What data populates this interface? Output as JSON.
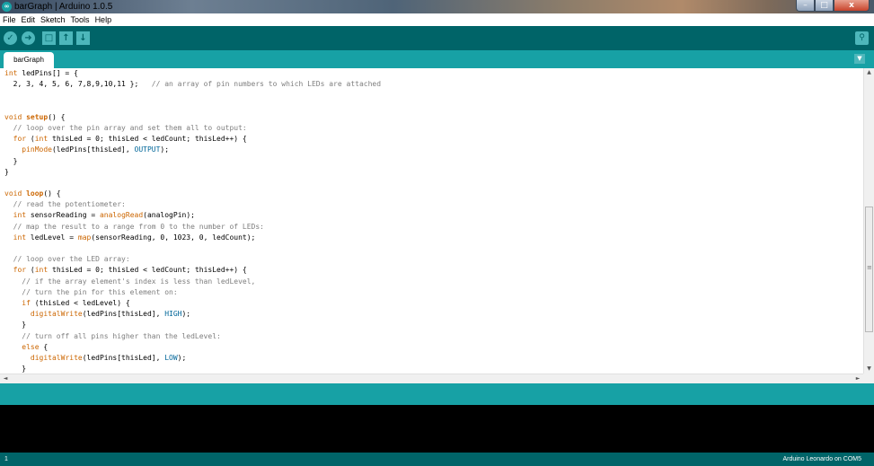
{
  "window": {
    "title": "barGraph | Arduino 1.0.5",
    "icon": "arduino-icon",
    "controls": {
      "minimize": "–",
      "maximize": "□",
      "close": "x"
    }
  },
  "menu": {
    "items": [
      "File",
      "Edit",
      "Sketch",
      "Tools",
      "Help"
    ]
  },
  "toolbar": {
    "verify": "verify-check-icon",
    "upload": "upload-arrow-icon",
    "new": "new-file-icon",
    "open": "open-up-arrow-icon",
    "save": "save-down-arrow-icon",
    "serial_monitor": "magnifier-icon"
  },
  "tabs": {
    "active": "barGraph",
    "menu": "tab-menu-icon"
  },
  "colors": {
    "teal_dark": "#006468",
    "teal_light": "#17a1a5",
    "keyword": "#cc6600",
    "comment": "#7e7e7e",
    "constant": "#006699"
  },
  "editor": {
    "lines": [
      [
        {
          "t": "int",
          "c": "kw"
        },
        {
          "t": " ledPins[] = {"
        }
      ],
      [
        {
          "t": "  2, 3, 4, 5, 6, 7,8,9,10,11 };   "
        },
        {
          "t": "// an array of pin numbers to which LEDs are attached",
          "c": "cm"
        }
      ],
      [],
      [],
      [
        {
          "t": "void",
          "c": "kw"
        },
        {
          "t": " "
        },
        {
          "t": "setup",
          "c": "kwb"
        },
        {
          "t": "() {"
        }
      ],
      [
        {
          "t": "  "
        },
        {
          "t": "// loop over the pin array and set them all to output:",
          "c": "cm"
        }
      ],
      [
        {
          "t": "  "
        },
        {
          "t": "for",
          "c": "kw"
        },
        {
          "t": " ("
        },
        {
          "t": "int",
          "c": "kw"
        },
        {
          "t": " thisLed = 0; thisLed < ledCount; thisLed++) {"
        }
      ],
      [
        {
          "t": "    "
        },
        {
          "t": "pinMode",
          "c": "kw"
        },
        {
          "t": "(ledPins[thisLed], "
        },
        {
          "t": "OUTPUT",
          "c": "cst"
        },
        {
          "t": ");"
        }
      ],
      [
        {
          "t": "  }"
        }
      ],
      [
        {
          "t": "}"
        }
      ],
      [],
      [
        {
          "t": "void",
          "c": "kw"
        },
        {
          "t": " "
        },
        {
          "t": "loop",
          "c": "kwb"
        },
        {
          "t": "() {"
        }
      ],
      [
        {
          "t": "  "
        },
        {
          "t": "// read the potentiometer:",
          "c": "cm"
        }
      ],
      [
        {
          "t": "  "
        },
        {
          "t": "int",
          "c": "kw"
        },
        {
          "t": " sensorReading = "
        },
        {
          "t": "analogRead",
          "c": "kw"
        },
        {
          "t": "(analogPin);"
        }
      ],
      [
        {
          "t": "  "
        },
        {
          "t": "// map the result to a range from 0 to the number of LEDs:",
          "c": "cm"
        }
      ],
      [
        {
          "t": "  "
        },
        {
          "t": "int",
          "c": "kw"
        },
        {
          "t": " ledLevel = "
        },
        {
          "t": "map",
          "c": "kw"
        },
        {
          "t": "(sensorReading, 0, 1023, 0, ledCount);"
        }
      ],
      [],
      [
        {
          "t": "  "
        },
        {
          "t": "// loop over the LED array:",
          "c": "cm"
        }
      ],
      [
        {
          "t": "  "
        },
        {
          "t": "for",
          "c": "kw"
        },
        {
          "t": " ("
        },
        {
          "t": "int",
          "c": "kw"
        },
        {
          "t": " thisLed = 0; thisLed < ledCount; thisLed++) {"
        }
      ],
      [
        {
          "t": "    "
        },
        {
          "t": "// if the array element's index is less than ledLevel,",
          "c": "cm"
        }
      ],
      [
        {
          "t": "    "
        },
        {
          "t": "// turn the pin for this element on:",
          "c": "cm"
        }
      ],
      [
        {
          "t": "    "
        },
        {
          "t": "if",
          "c": "kw"
        },
        {
          "t": " (thisLed < ledLevel) {"
        }
      ],
      [
        {
          "t": "      "
        },
        {
          "t": "digitalWrite",
          "c": "kw"
        },
        {
          "t": "(ledPins[thisLed], "
        },
        {
          "t": "HIGH",
          "c": "cst"
        },
        {
          "t": ");"
        }
      ],
      [
        {
          "t": "    }"
        }
      ],
      [
        {
          "t": "    "
        },
        {
          "t": "// turn off all pins higher than the ledLevel:",
          "c": "cm"
        }
      ],
      [
        {
          "t": "    "
        },
        {
          "t": "else",
          "c": "kw"
        },
        {
          "t": " {"
        }
      ],
      [
        {
          "t": "      "
        },
        {
          "t": "digitalWrite",
          "c": "kw"
        },
        {
          "t": "(ledPins[thisLed], "
        },
        {
          "t": "LOW",
          "c": "cst"
        },
        {
          "t": ");"
        }
      ],
      [
        {
          "t": "    }"
        }
      ]
    ]
  },
  "scrollbars": {
    "up": "▲",
    "down": "▼",
    "left": "◄",
    "right": "►",
    "grip": "≡"
  },
  "footer": {
    "line_number": "1",
    "board": "Arduino Leonardo on COM5"
  }
}
